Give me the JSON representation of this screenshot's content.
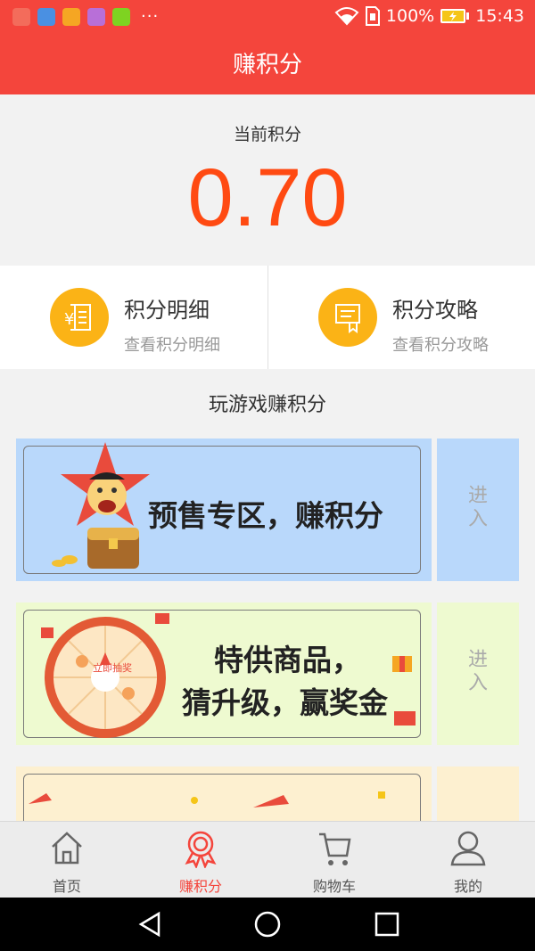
{
  "status_bar": {
    "battery": "100%",
    "time": "15:43",
    "more": "···"
  },
  "header": {
    "title": "赚积分"
  },
  "points": {
    "label": "当前积分",
    "value": "0.70"
  },
  "entries": [
    {
      "title": "积分明细",
      "subtitle": "查看积分明细",
      "icon": "yuan-receipt-icon"
    },
    {
      "title": "积分攻略",
      "subtitle": "查看积分攻略",
      "icon": "guide-book-icon"
    }
  ],
  "section": {
    "title": "玩游戏赚积分"
  },
  "banners": [
    {
      "line1": "预售专区，赚积分",
      "line2": "",
      "enter": "进入",
      "bg": "#b9d8fb"
    },
    {
      "line1": "特供商品，",
      "line2": "猜升级，赢奖金",
      "enter": "进入",
      "bg": "#eefad0"
    },
    {
      "line1": "",
      "line2": "",
      "enter": "",
      "bg": "#fdf0d0"
    }
  ],
  "wheel": {
    "label": "立即抽奖"
  },
  "tabs": [
    {
      "label": "首页",
      "icon": "home-icon",
      "active": false
    },
    {
      "label": "赚积分",
      "icon": "medal-icon",
      "active": true
    },
    {
      "label": "购物车",
      "icon": "cart-icon",
      "active": false
    },
    {
      "label": "我的",
      "icon": "profile-icon",
      "active": false
    }
  ],
  "colors": {
    "brand": "#f4453c",
    "points": "#ff4a12",
    "icon_bg": "#fbb316"
  }
}
